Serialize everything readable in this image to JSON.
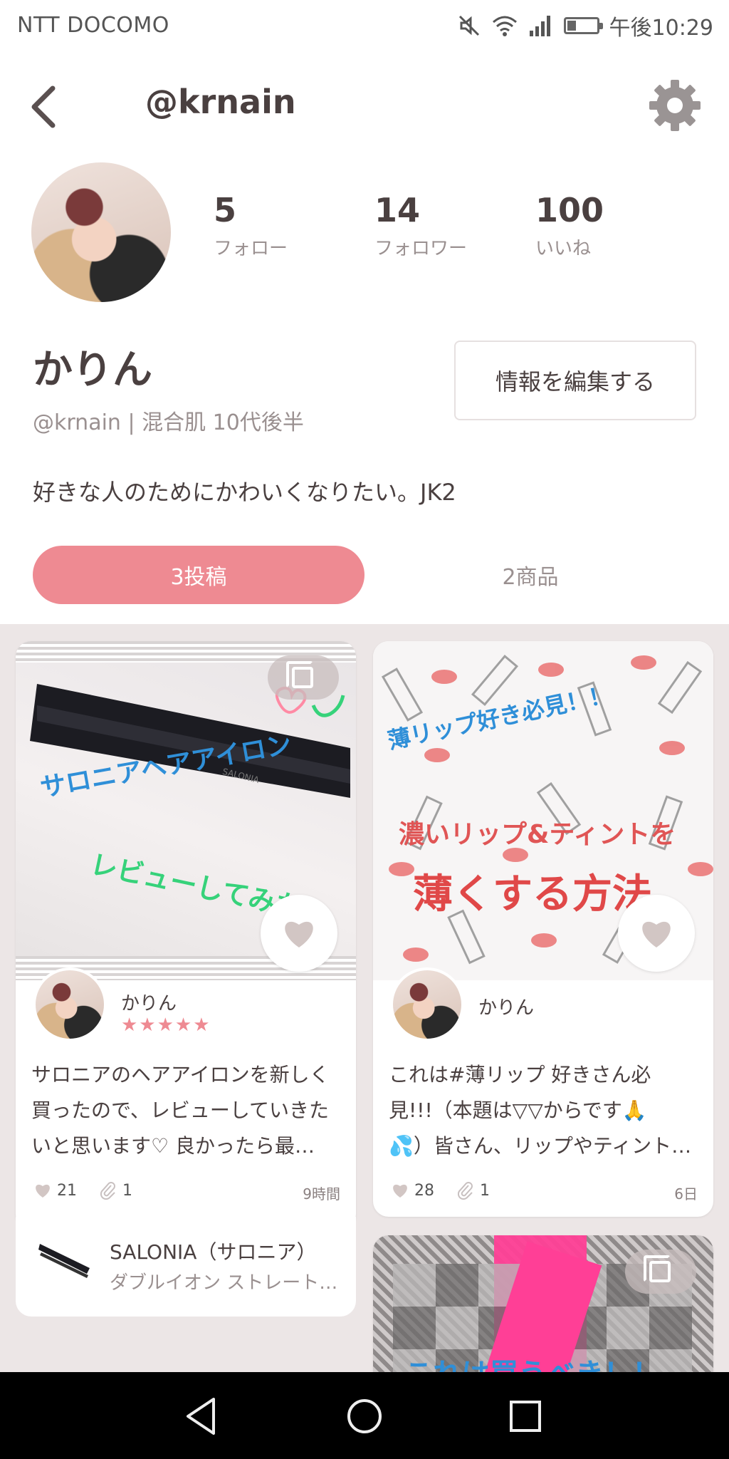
{
  "status_bar": {
    "carrier": "NTT DOCOMO",
    "time": "午後10:29",
    "icons": [
      "mute-icon",
      "wifi-icon",
      "signal-icon",
      "battery-icon"
    ]
  },
  "header": {
    "title": "@krnain",
    "back_icon": "chevron-left-icon",
    "settings_icon": "gear-icon"
  },
  "profile": {
    "stats": [
      {
        "value": "5",
        "label": "フォロー"
      },
      {
        "value": "14",
        "label": "フォロワー"
      },
      {
        "value": "100",
        "label": "いいね"
      }
    ],
    "name": "かりん",
    "meta": "@krnain | 混合肌 10代後半",
    "edit_button": "情報を編集する",
    "bio": "好きな人のためにかわいくなりたい。JK2"
  },
  "tabs": {
    "posts": "3投稿",
    "products": "2商品"
  },
  "posts": [
    {
      "image_text_1": "サロニアヘアアイロン",
      "image_text_2": "レビューしてみた",
      "image_brand": "SALONIA",
      "user": "かりん",
      "stars": "★★★★★",
      "text_1": "サロニアのヘアアイロンを新しく",
      "text_2": "買ったので、レビューしていきた",
      "text_3": "いと思います♡ 良かったら最…",
      "likes": "21",
      "clips": "1",
      "time": "9時間",
      "product_name": "SALONIA（サロニア）",
      "product_sub": "ダブルイオン ストレート…"
    },
    {
      "image_text_1": "薄リップ好き必見！！",
      "image_text_2": "濃いリップ&ティントを",
      "image_text_3": "薄くする方法",
      "user": "かりん",
      "text_1": "これは#薄リップ 好きさん必",
      "text_2": "見!!!（本題は▽▽からです🙏",
      "text_3": "💦）皆さん、リップやティント…",
      "likes": "28",
      "clips": "1",
      "time": "6日"
    },
    {
      "image_text_1": "これは買うべき！！"
    }
  ],
  "colors": {
    "accent": "#ee8a92",
    "feed_bg": "#ece6e6",
    "text": "#4a4040",
    "muted": "#9a9090"
  }
}
